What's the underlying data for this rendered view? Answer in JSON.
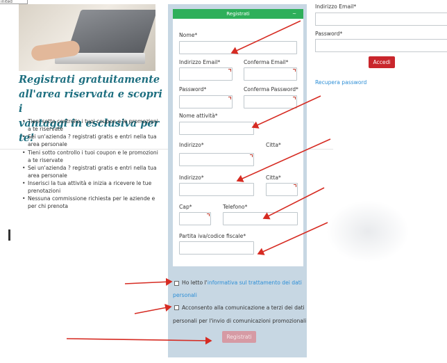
{
  "top_strip_text": "inited",
  "hero": {
    "headline_line1": "Registrati gratuitamente",
    "headline_line2": "all'area riservata e scopri i",
    "headline_line3": "vantaggi in esclusiva per te!",
    "bullets_top": [
      "Tieni sotto controllo i tuoi coupon e le promozioni a te riservate",
      "Sei un'azienda ? registrati gratis e entri nella tua area personale"
    ],
    "bullets_bottom": [
      "Tieni sotto controllo i tuoi coupon e le promozioni a te riservate",
      "Sei un'azienda ? registrati gratis e entri nella tua area personale",
      "Inserisci la tua attività e inizia a ricevere le tue prenotazioni",
      "Nessuna commissione richiesta per le aziende e per chi prenota"
    ]
  },
  "form": {
    "header": "Registrati",
    "caret": "~",
    "nome": "Nome*",
    "email": "Indirizzo Email*",
    "email_confirm": "Conferma Email*",
    "password": "Password*",
    "password_confirm": "Conferma Password*",
    "attivita": "Nome attività*",
    "indirizzo_overlap": "Indirizzo*",
    "citta_overlap": "Citta*",
    "indirizzo": "Indirizzo*",
    "citta": "Citta*",
    "cap": "Cap*",
    "telefono": "Telefono*",
    "piva": "Partita iva/codice fiscale*",
    "privacy_prefix": "Ho letto l'",
    "privacy_link": "informativa sul trattamento dei dati",
    "privacy_link2": "personali",
    "consent_line1": "Acconsento alla comunicazione a terzi dei dati",
    "consent_line2": "personali per l'invio di comunicazioni promozionali",
    "submit": "Registrati"
  },
  "login": {
    "email_label": "Indirizzo Email*",
    "password_label": "Password*",
    "button": "Accedi",
    "recover": "Recupera password"
  },
  "colors": {
    "header_green": "#2eaf5a",
    "panel_blue": "#c7d7e3",
    "headline_teal": "#1e6f80",
    "link_blue": "#2c8ed6",
    "login_red": "#c9262c",
    "submit_disabled": "#d69aa4",
    "arrow_red": "#d62b22"
  }
}
